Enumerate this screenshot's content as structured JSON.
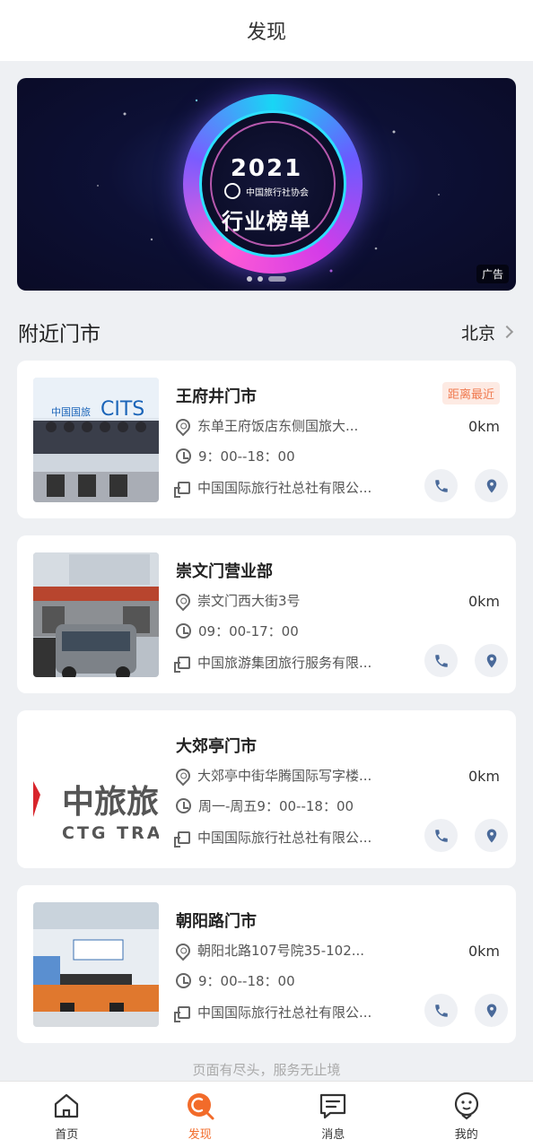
{
  "header": {
    "title": "发现"
  },
  "banner": {
    "year": "2021",
    "association": "中国旅行社协会",
    "subtitle": "行业榜单",
    "ad_label": "广告",
    "slide_count": 3,
    "active_slide": 3
  },
  "section": {
    "title": "附近门市",
    "city": "北京"
  },
  "stores": [
    {
      "name": "王府井门市",
      "badge": "距离最近",
      "address": "东单王府饭店东侧国旅大...",
      "hours": "9：00--18：00",
      "company": "中国国际旅行社总社有限公...",
      "distance": "0km"
    },
    {
      "name": "崇文门营业部",
      "badge": "",
      "address": "崇文门西大街3号",
      "hours": "09：00-17：00",
      "company": "中国旅游集团旅行服务有限...",
      "distance": "0km"
    },
    {
      "name": "大郊亭门市",
      "badge": "",
      "address": "大郊亭中街华腾国际写字楼...",
      "hours": "周一-周五9：00--18：00",
      "company": "中国国际旅行社总社有限公...",
      "distance": "0km"
    },
    {
      "name": "朝阳路门市",
      "badge": "",
      "address": "朝阳北路107号院35-102...",
      "hours": "9：00--18：00",
      "company": "中国国际旅行社总社有限公...",
      "distance": "0km"
    }
  ],
  "thumbs": {
    "cits_sign": "CITS",
    "cits_cn": "中国国旅",
    "ctg_cn": "中旅旅",
    "ctg_en": "CTG TRA"
  },
  "footer_note": "页面有尽头，服务无止境",
  "tabs": [
    {
      "label": "首页",
      "icon": "home-icon"
    },
    {
      "label": "发现",
      "icon": "discover-icon"
    },
    {
      "label": "消息",
      "icon": "message-icon"
    },
    {
      "label": "我的",
      "icon": "profile-icon"
    }
  ],
  "colors": {
    "accent": "#f26b2a",
    "badge_bg": "#fdeae3",
    "badge_text": "#f07a4f",
    "icon_blue": "#4a6a9a"
  }
}
